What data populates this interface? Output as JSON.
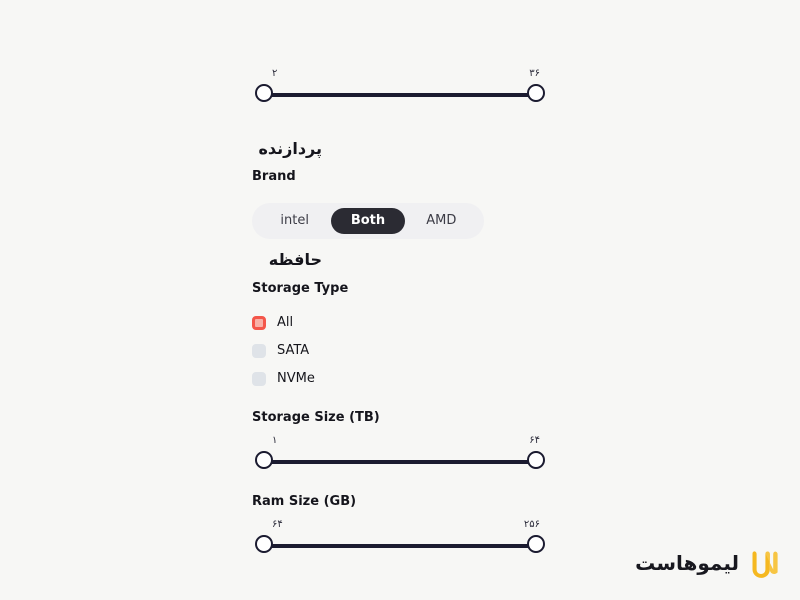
{
  "page": {
    "background_color": "#f7f7f5",
    "accent_color": "#f4564a",
    "dark_color": "#1b1b30",
    "logo_color": "#f5b820"
  },
  "top_slider": {
    "name": "cpu-core-count",
    "min_label": "۲",
    "max_label": "۳۶"
  },
  "processor": {
    "group_title": "پردازنده",
    "brand_label": "Brand",
    "brand_options": [
      {
        "label": "intel",
        "active": false
      },
      {
        "label": "Both",
        "active": true
      },
      {
        "label": "AMD",
        "active": false
      }
    ]
  },
  "memory": {
    "group_title": "حافظه",
    "storage_type_label": "Storage Type",
    "storage_type_options": [
      {
        "label": "All",
        "checked": true
      },
      {
        "label": "SATA",
        "checked": false
      },
      {
        "label": "NVMe",
        "checked": false
      }
    ],
    "storage_size": {
      "label": "Storage Size (TB)",
      "min_label": "۱",
      "max_label": "۶۴"
    },
    "ram_size": {
      "label": "Ram Size (GB)",
      "min_label": "۶۴",
      "max_label": "۲۵۶"
    }
  },
  "logo": {
    "text": "لیموهاست",
    "mark": "limoohost-w-mark"
  }
}
